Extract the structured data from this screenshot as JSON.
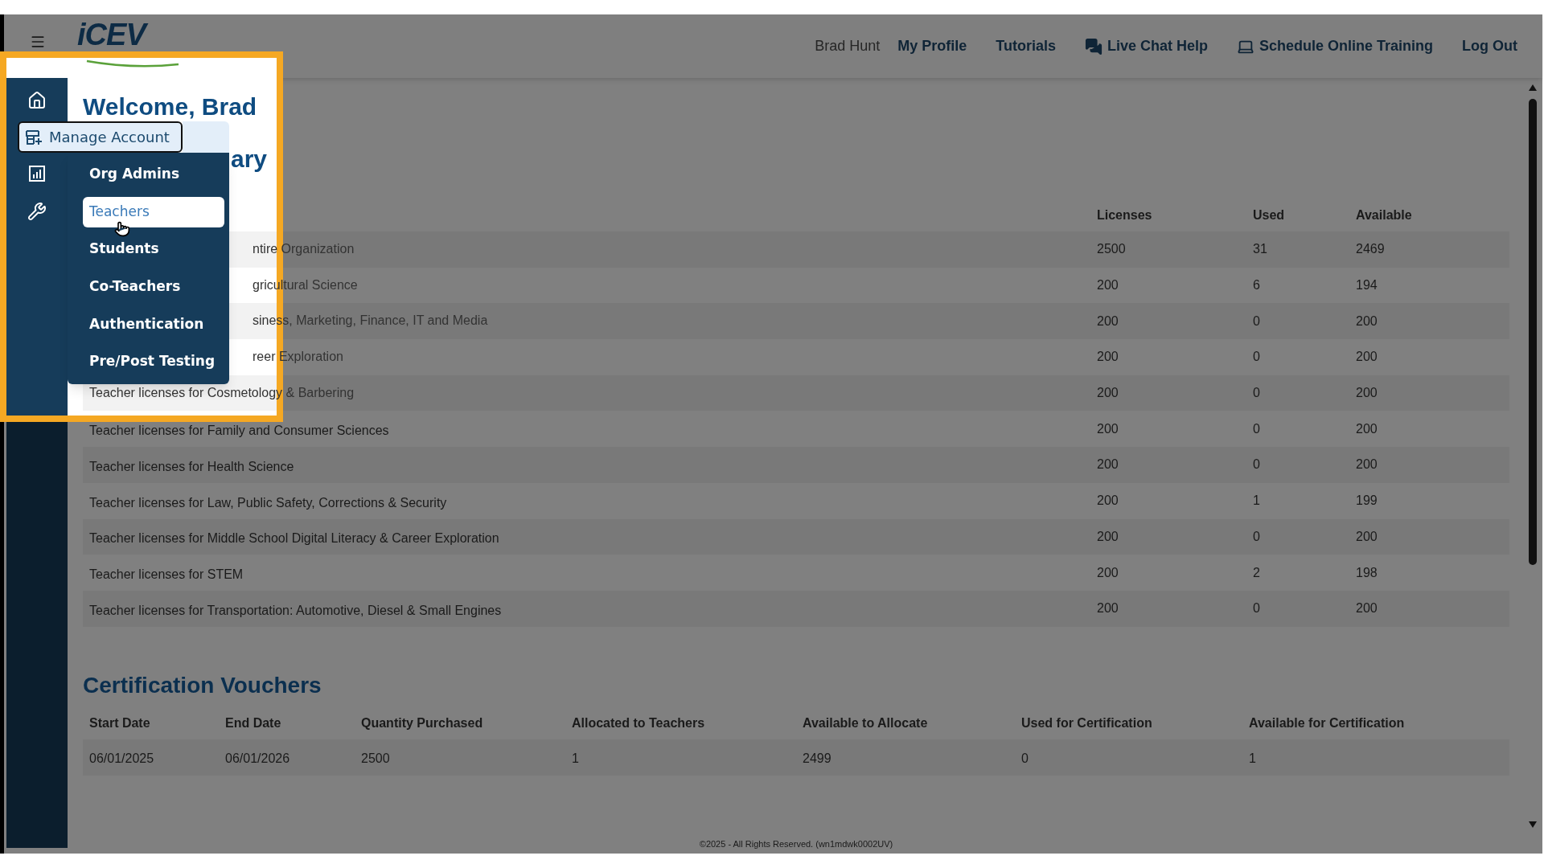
{
  "top_bar": {
    "logo": "iCEV",
    "user_name": "Brad Hunt",
    "links": [
      {
        "label": "My Profile",
        "kind": "plain"
      },
      {
        "label": "Tutorials",
        "kind": "plain"
      },
      {
        "label": "Live Chat Help",
        "kind": "chat"
      },
      {
        "label": "Schedule Online Training",
        "kind": "laptop"
      },
      {
        "label": "Log Out",
        "kind": "plain"
      }
    ]
  },
  "welcome": "Welcome, Brad",
  "summary_heading": "ary",
  "menu": {
    "button": "Manage Account",
    "items": [
      {
        "label": "Org Admins",
        "selected": false
      },
      {
        "label": "Teachers",
        "selected": true
      },
      {
        "label": "Students",
        "selected": false
      },
      {
        "label": "Co-Teachers",
        "selected": false
      },
      {
        "label": "Authentication",
        "selected": false
      },
      {
        "label": "Pre/Post Testing",
        "selected": false
      }
    ]
  },
  "licenses": {
    "columns": [
      "Licenses",
      "Used",
      "Available"
    ],
    "rows": [
      {
        "label": "ntire Organization",
        "licenses": "2500",
        "used": "31",
        "available": "2469",
        "highlighted": true,
        "cut": true
      },
      {
        "label": "gricultural Science",
        "licenses": "200",
        "used": "6",
        "available": "194",
        "highlighted": true,
        "cut": true
      },
      {
        "label": "siness, Marketing, Finance, IT and Media",
        "licenses": "200",
        "used": "0",
        "available": "200",
        "highlighted": true,
        "cut": true
      },
      {
        "label": "reer Exploration",
        "licenses": "200",
        "used": "0",
        "available": "200",
        "highlighted": true,
        "cut": true
      },
      {
        "label": "Teacher licenses for Cosmetology & Barbering",
        "licenses": "200",
        "used": "0",
        "available": "200",
        "highlighted": true,
        "cut": false
      },
      {
        "label": "Teacher licenses for Family and Consumer Sciences",
        "licenses": "200",
        "used": "0",
        "available": "200",
        "highlighted": false,
        "cut": false
      },
      {
        "label": "Teacher licenses for Health Science",
        "licenses": "200",
        "used": "0",
        "available": "200",
        "highlighted": false,
        "cut": false
      },
      {
        "label": "Teacher licenses for Law, Public Safety, Corrections & Security",
        "licenses": "200",
        "used": "1",
        "available": "199",
        "highlighted": false,
        "cut": false
      },
      {
        "label": "Teacher licenses for Middle School Digital Literacy & Career Exploration",
        "licenses": "200",
        "used": "0",
        "available": "200",
        "highlighted": false,
        "cut": false
      },
      {
        "label": "Teacher licenses for STEM",
        "licenses": "200",
        "used": "2",
        "available": "198",
        "highlighted": false,
        "cut": false
      },
      {
        "label": "Teacher licenses for Transportation: Automotive, Diesel & Small Engines",
        "licenses": "200",
        "used": "0",
        "available": "200",
        "highlighted": false,
        "cut": false
      }
    ]
  },
  "vouchers": {
    "title": "Certification Vouchers",
    "columns": [
      "Start Date",
      "End Date",
      "Quantity Purchased",
      "Allocated to Teachers",
      "Available to Allocate",
      "Used for Certification",
      "Available for Certification"
    ],
    "rows": [
      [
        "06/01/2025",
        "06/01/2026",
        "2500",
        "1",
        "2499",
        "0",
        "1"
      ]
    ]
  },
  "footer": "©2025 - All Rights Reserved. (wn1mdwk0002UV)"
}
